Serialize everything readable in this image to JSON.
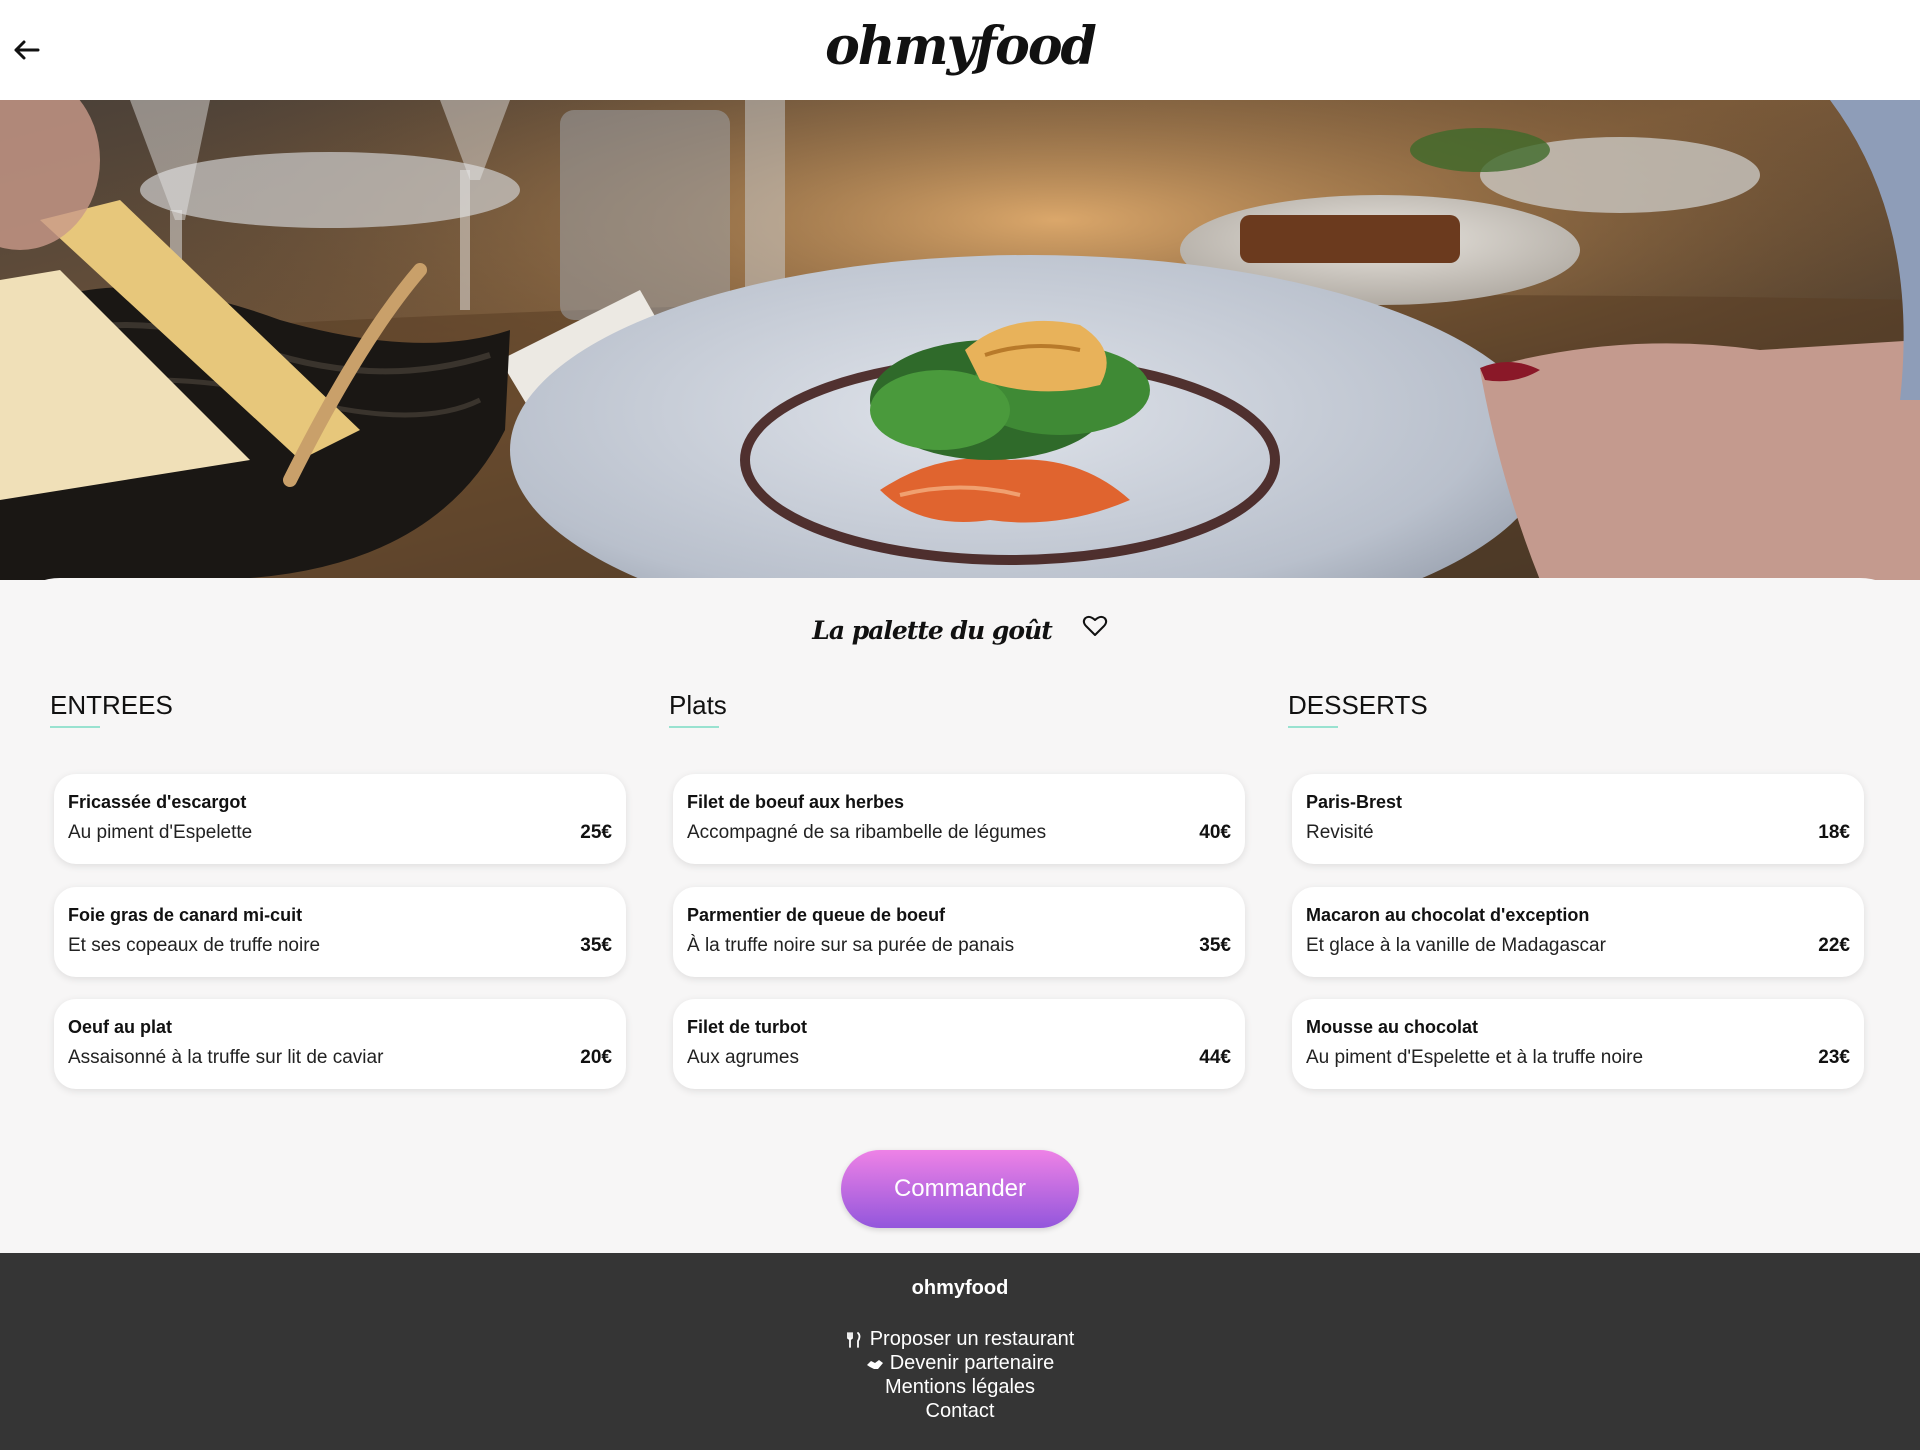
{
  "header": {
    "back_icon": "arrow-left-icon",
    "logo": "ohmyfood"
  },
  "restaurant": {
    "name": "La palette du goût",
    "favorite_icon": "heart-outline-icon"
  },
  "menu": {
    "columns": [
      {
        "heading": "ENTREES",
        "items": [
          {
            "name": "Fricassée d'escargot",
            "description": "Au piment d'Espelette",
            "price": "25€"
          },
          {
            "name": "Foie gras de canard mi-cuit",
            "description": "Et ses copeaux de truffe noire",
            "price": "35€"
          },
          {
            "name": "Oeuf au plat",
            "description": "Assaisonné à la truffe sur lit de caviar",
            "price": "20€"
          }
        ]
      },
      {
        "heading": "Plats",
        "items": [
          {
            "name": "Filet de boeuf aux herbes",
            "description": "Accompagné de sa ribambelle de légumes",
            "price": "40€"
          },
          {
            "name": "Parmentier de queue de boeuf",
            "description": "À la truffe noire sur sa purée de panais",
            "price": "35€"
          },
          {
            "name": "Filet de turbot",
            "description": "Aux agrumes",
            "price": "44€"
          }
        ]
      },
      {
        "heading": "DESSERTS",
        "items": [
          {
            "name": "Paris-Brest",
            "description": "Revisité",
            "price": "18€"
          },
          {
            "name": "Macaron au chocolat d'exception",
            "description": "Et glace à la vanille de Madagascar",
            "price": "22€"
          },
          {
            "name": "Mousse au chocolat",
            "description": "Au piment d'Espelette et à la truffe noire",
            "price": "23€"
          }
        ]
      }
    ]
  },
  "order_button": "Commander",
  "footer": {
    "brand": "ohmyfood",
    "links": [
      {
        "label": "Proposer un restaurant",
        "icon": "utensils-icon"
      },
      {
        "label": "Devenir partenaire",
        "icon": "handshake-icon"
      },
      {
        "label": "Mentions légales",
        "icon": ""
      },
      {
        "label": "Contact",
        "icon": ""
      }
    ]
  },
  "colors": {
    "accent_underline": "#99e2d0",
    "button_gradient_top": "#ee82e6",
    "button_gradient_bottom": "#9356dc",
    "footer_bg": "#353535"
  }
}
